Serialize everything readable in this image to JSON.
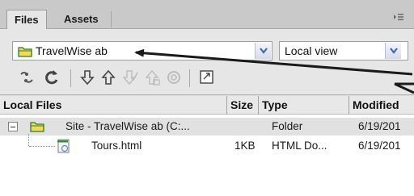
{
  "tabs": [
    {
      "label": "Files",
      "active": true
    },
    {
      "label": "Assets",
      "active": false
    }
  ],
  "panel_menu_icon": "panel-options-menu-icon",
  "site_selector": {
    "value": "TravelWise ab",
    "icon": "folder-icon"
  },
  "view_selector": {
    "value": "Local view"
  },
  "toolbar": {
    "icons": [
      "connect-icon",
      "refresh-icon",
      "get-down-arrow-icon",
      "put-up-arrow-icon",
      "check-out-icon",
      "check-in-icon",
      "synchronize-icon",
      "expand-panel-icon"
    ]
  },
  "table": {
    "columns": [
      "Local Files",
      "Size",
      "Type",
      "Modified"
    ],
    "rows": [
      {
        "name": "Site - TravelWise ab (C:...",
        "size": "",
        "type": "Folder",
        "modified": "6/19/201",
        "icon": "folder-icon"
      },
      {
        "name": "Tours.html",
        "size": "1KB",
        "type": "HTML Do...",
        "modified": "6/19/201",
        "icon": "html-file-icon"
      }
    ]
  },
  "colors": {
    "arrow": "#1a1a1a",
    "folder_yellow": "#f5d75a",
    "dropdown_arrow": "#3c66b8"
  }
}
